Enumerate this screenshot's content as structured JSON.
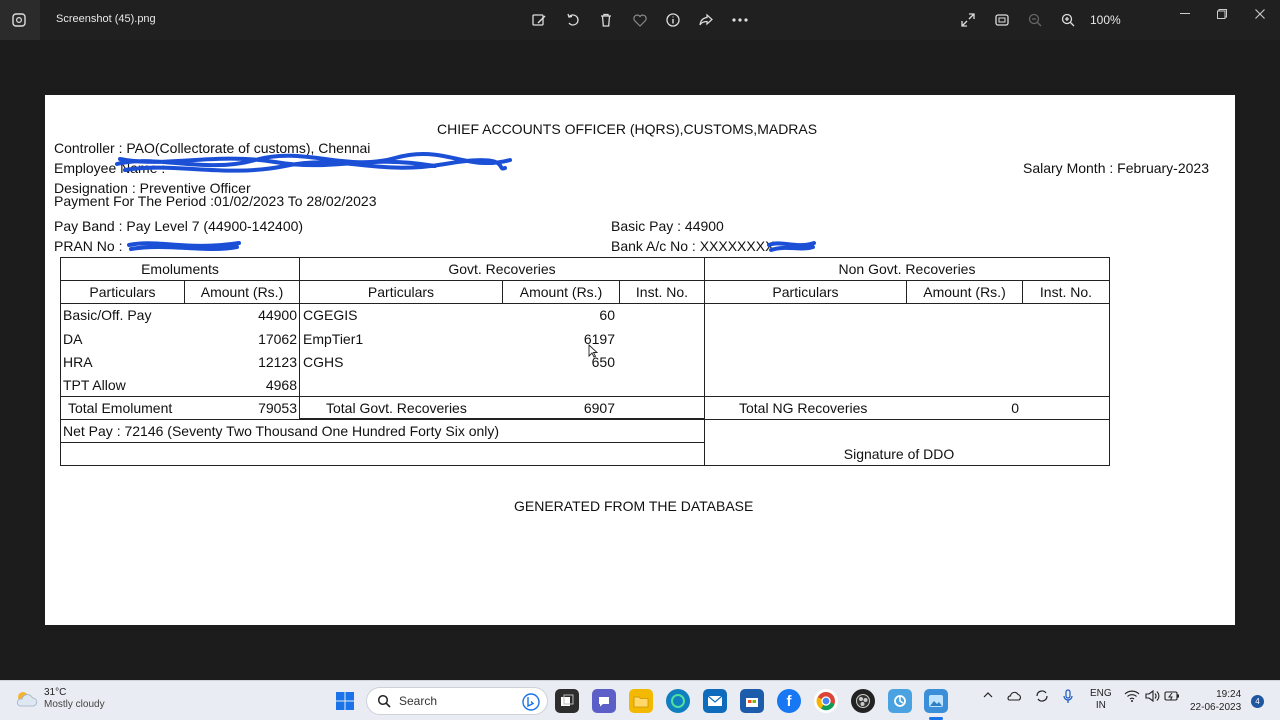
{
  "titlebar": {
    "file_name": "Screenshot (45).png",
    "zoom": "100%"
  },
  "toolbar_icons": [
    "edit-image-icon",
    "rotate-icon",
    "delete-icon",
    "favorite-icon",
    "info-icon",
    "share-icon",
    "more-icon",
    "full-screen-icon",
    "fit-window-icon",
    "zoom-out-icon",
    "zoom-in-icon"
  ],
  "payslip": {
    "heading": "CHIEF ACCOUNTS OFFICER  (HQRS),CUSTOMS,MADRAS",
    "controller": "Controller : PAO(Collectorate of customs), Chennai",
    "employee_name": "Employee Name :",
    "salary_month": "Salary Month : February-2023",
    "designation": "Designation : Preventive Officer",
    "period": "Payment For The Period :01/02/2023 To 28/02/2023",
    "pay_band": "Pay Band : Pay Level 7   (44900-142400)",
    "basic_pay": "Basic Pay : 44900",
    "pran": "PRAN No :",
    "bank": "Bank A/c No : XXXXXXXX",
    "sections": {
      "emoluments": "Emoluments",
      "govt": "Govt. Recoveries",
      "non_govt": "Non Govt. Recoveries"
    },
    "columns": {
      "particulars": "Particulars",
      "amount": "Amount (Rs.)",
      "inst": "Inst. No."
    },
    "emoluments": [
      {
        "name": "Basic/Off. Pay",
        "amount": "44900"
      },
      {
        "name": "DA",
        "amount": "17062"
      },
      {
        "name": "HRA",
        "amount": "12123"
      },
      {
        "name": "TPT Allow",
        "amount": "4968"
      }
    ],
    "govt_recoveries": [
      {
        "name": "CGEGIS",
        "amount": "60"
      },
      {
        "name": "EmpTier1",
        "amount": "6197"
      },
      {
        "name": "CGHS",
        "amount": "650"
      }
    ],
    "totals": {
      "emolument_label": "Total Emolument",
      "emolument_value": "79053",
      "govt_label": "Total Govt. Recoveries",
      "govt_value": "6907",
      "ng_label": "Total NG Recoveries",
      "ng_value": "0"
    },
    "net_pay": "Net Pay  : 72146  (Seventy Two Thousand One Hundred Forty Six only)",
    "signature": "Signature of DDO",
    "footer": "GENERATED FROM THE DATABASE"
  },
  "taskbar": {
    "temperature": "31°C",
    "weather": "Mostly cloudy",
    "search_placeholder": "Search",
    "language_top": "ENG",
    "language_bottom": "IN",
    "time": "19:24",
    "date": "22-06-2023",
    "notifications": "4"
  },
  "colors": {
    "titlebar": "#202020",
    "viewer_bg": "#1c1c1c",
    "page": "#ffffff",
    "redaction": "#1a4fd6",
    "taskbar": "#e9ecf2"
  }
}
